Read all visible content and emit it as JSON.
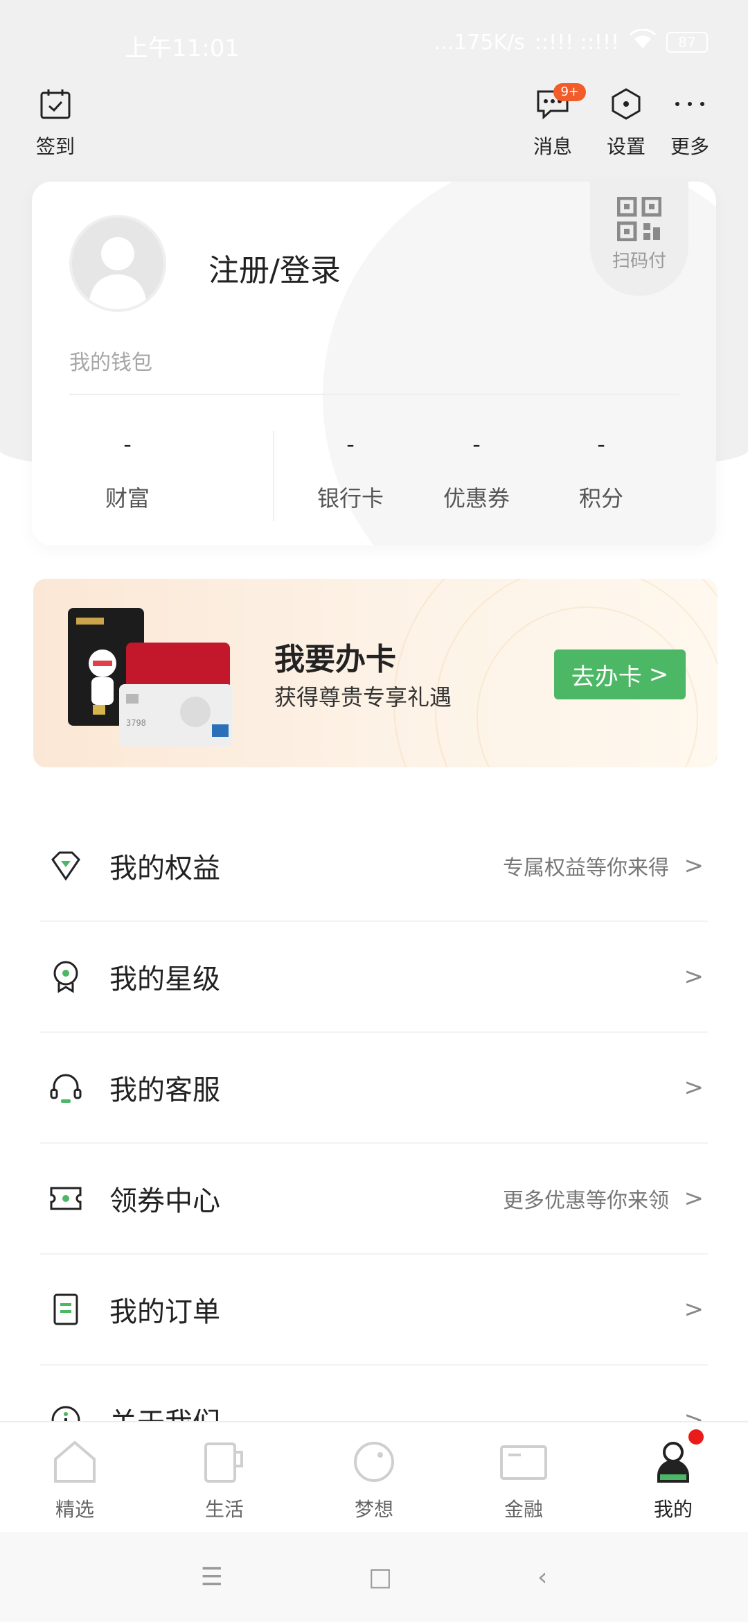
{
  "status_bar": {
    "time": "上午11:01",
    "network": "...175K/s",
    "signal": "::!!! ::!!!",
    "battery": "87"
  },
  "header": {
    "checkin_label": "签到",
    "messages_label": "消息",
    "messages_badge": "9+",
    "settings_label": "设置",
    "more_label": "更多"
  },
  "profile": {
    "login_text": "注册/登录",
    "scan_pay_label": "扫码付",
    "wallet_label": "我的钱包",
    "stats": [
      {
        "value": "-",
        "label": "财富"
      },
      {
        "value": "-",
        "label": "银行卡"
      },
      {
        "value": "-",
        "label": "优惠券"
      },
      {
        "value": "-",
        "label": "积分"
      }
    ]
  },
  "promo": {
    "title": "我要办卡",
    "subtitle": "获得尊贵专享礼遇",
    "button_label": "去办卡",
    "button_chevron": ">",
    "colors": {
      "button": "#4cb764"
    }
  },
  "menu": [
    {
      "label": "我的权益",
      "hint": "专属权益等你来得",
      "icon": "diamond-icon"
    },
    {
      "label": "我的星级",
      "hint": "",
      "icon": "star-level-icon"
    },
    {
      "label": "我的客服",
      "hint": "",
      "icon": "headset-icon"
    },
    {
      "label": "领券中心",
      "hint": "更多优惠等你来领",
      "icon": "coupon-icon"
    },
    {
      "label": "我的订单",
      "hint": "",
      "icon": "order-icon"
    },
    {
      "label": "关于我们",
      "hint": "",
      "icon": "info-icon"
    }
  ],
  "menu_chevron": ">",
  "tabs": [
    {
      "label": "精选",
      "icon": "home-icon",
      "active": false
    },
    {
      "label": "生活",
      "icon": "cup-icon",
      "active": false
    },
    {
      "label": "梦想",
      "icon": "dream-icon",
      "active": false
    },
    {
      "label": "金融",
      "icon": "card-icon",
      "active": false
    },
    {
      "label": "我的",
      "icon": "user-icon",
      "active": true
    }
  ],
  "nav": {
    "menu": "☰",
    "home": "□",
    "back": "‹"
  }
}
